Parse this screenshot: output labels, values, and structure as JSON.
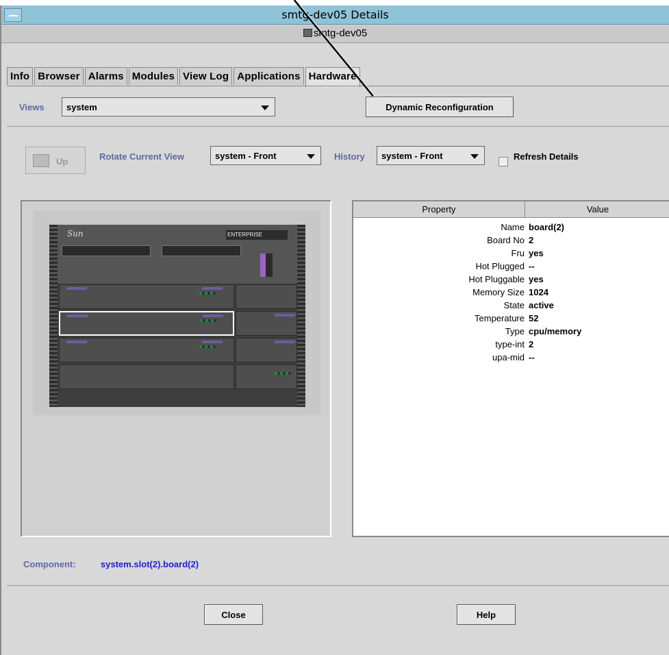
{
  "window": {
    "title": "smtg-dev05 Details",
    "host": "smtg-dev05"
  },
  "tabs": [
    {
      "label": "Info"
    },
    {
      "label": "Browser"
    },
    {
      "label": "Alarms"
    },
    {
      "label": "Modules"
    },
    {
      "label": "View Log"
    },
    {
      "label": "Applications"
    },
    {
      "label": "Hardware"
    }
  ],
  "active_tab": "Hardware",
  "views": {
    "label": "Views",
    "value": "system"
  },
  "dynamic_reconfiguration_label": "Dynamic Reconfiguration",
  "toolbar": {
    "up_label": "Up",
    "rotate_label": "Rotate Current View",
    "rotate_value": "system - Front",
    "history_label": "History",
    "history_value": "system - Front",
    "refresh_label": "Refresh Details"
  },
  "hardware_image": {
    "brand": "Sun",
    "model_badge": "ENTERPRISE"
  },
  "properties": {
    "headers": [
      "Property",
      "Value"
    ],
    "rows": [
      {
        "property": "Name",
        "value": "board(2)"
      },
      {
        "property": "Board No",
        "value": "2"
      },
      {
        "property": "Fru",
        "value": "yes"
      },
      {
        "property": "Hot Plugged",
        "value": "--"
      },
      {
        "property": "Hot Pluggable",
        "value": "yes"
      },
      {
        "property": "Memory Size",
        "value": "1024"
      },
      {
        "property": "State",
        "value": "active"
      },
      {
        "property": "Temperature",
        "value": "52"
      },
      {
        "property": "Type",
        "value": "cpu/memory"
      },
      {
        "property": "type-int",
        "value": "2"
      },
      {
        "property": "upa-mid",
        "value": "--"
      }
    ]
  },
  "component": {
    "label": "Component:",
    "value": "system.slot(2).board(2)"
  },
  "footer": {
    "close_label": "Close",
    "help_label": "Help"
  }
}
